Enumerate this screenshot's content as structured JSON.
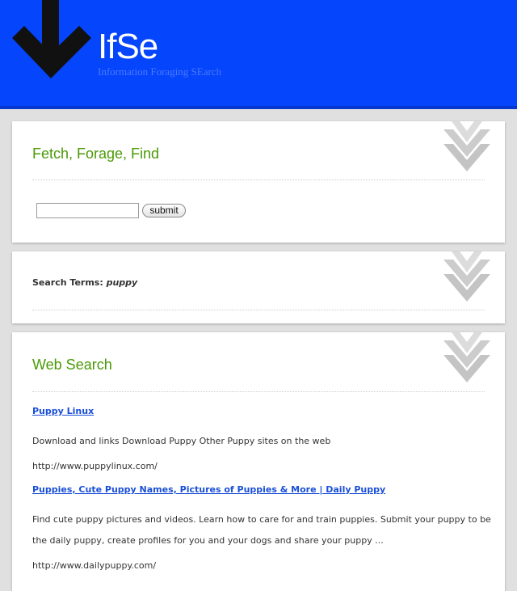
{
  "header": {
    "title": "IfSe",
    "subtitle": "Information Foraging SEarch",
    "background": "#0545fb"
  },
  "search_panel": {
    "heading": "Fetch, Forage, Find",
    "input_value": "",
    "submit_label": "submit"
  },
  "terms_panel": {
    "label": "Search Terms:",
    "query": "puppy"
  },
  "results_panel": {
    "heading": "Web Search",
    "results": [
      {
        "title": "Puppy Linux",
        "description": "Download and links Download Puppy Other Puppy sites on the web",
        "url": "http://www.puppylinux.com/"
      },
      {
        "title": "Puppies, Cute Puppy Names, Pictures of Puppies & More | Daily Puppy",
        "description": "Find cute puppy pictures and videos. Learn how to care for and train puppies. Submit your puppy to be the daily puppy, create profiles for you and your dogs and share your puppy ...",
        "url": "http://www.dailypuppy.com/"
      }
    ]
  },
  "colors": {
    "accent_green": "#4a9a06",
    "link_blue": "#1a4fd8",
    "page_gray": "#e0e0e0"
  },
  "icons": [
    "down-arrow-logo-icon",
    "double-chevron-down-icon"
  ]
}
